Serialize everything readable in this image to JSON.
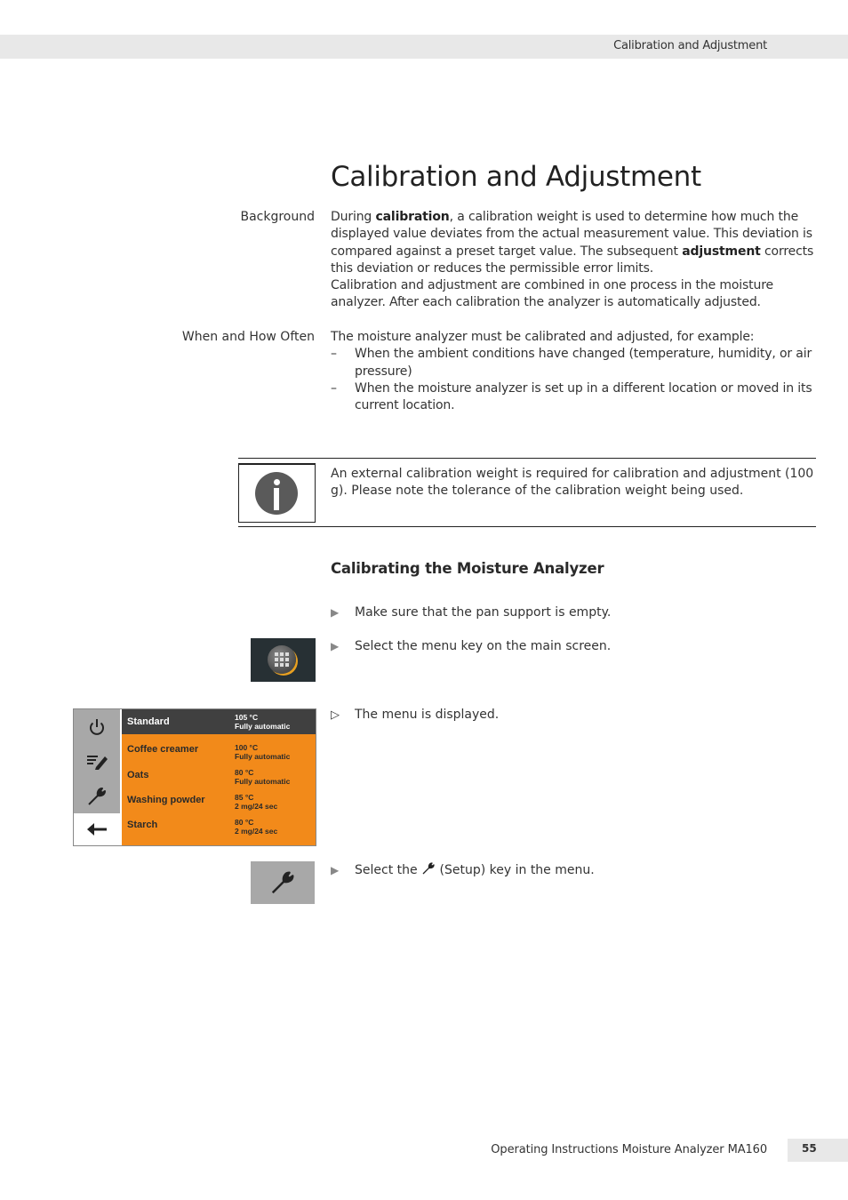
{
  "header": {
    "running_title": "Calibration and Adjustment"
  },
  "page_title": "Calibration and Adjustment",
  "background": {
    "label": "Background",
    "p1_a": "During ",
    "p1_bold1": "calibration",
    "p1_b": ", a calibration weight is used to determine how much the displayed value deviates from the actual measurement value. This deviation is compared against a preset target value. The subsequent ",
    "p1_bold2": "adjustment",
    "p1_c": " corrects this deviation or reduces the permissible error limits.",
    "p2": "Calibration and adjustment are combined in one process in the moisture analyzer. After each calibration the analyzer is automatically adjusted."
  },
  "when_how_often": {
    "label": "When and How Often",
    "intro": "The moisture analyzer must be calibrated and adjusted, for example:",
    "dash": "–",
    "items": [
      "When the ambient conditions have changed (temperature, humidity, or air pressure)",
      "When the moisture analyzer is set up in a different location or moved in its current location."
    ]
  },
  "info_note": {
    "icon": "info-icon",
    "text": "An external calibration weight is required for calibration and adjustment (100 g). Please note the tolerance of the calibration weight being used."
  },
  "section": {
    "heading": "Calibrating the Moisture Analyzer",
    "step_marker": "▶",
    "result_marker": "▷",
    "steps": [
      {
        "text": "Make sure that the pan support is empty."
      },
      {
        "text": "Select the menu key on the main screen.",
        "image_icon": "menu-grid-icon"
      },
      {
        "text": "The menu is displayed.",
        "is_result": true
      },
      {
        "text_before": "Select the ",
        "text_after": " (Setup) key in the menu.",
        "inline_icon": "wrench-icon",
        "image_icon": "wrench-icon"
      }
    ]
  },
  "device_menu": {
    "side_icons": [
      "power-icon",
      "edit-list-icon",
      "wrench-icon",
      "back-arrow-icon"
    ],
    "rows": [
      {
        "name": "Standard",
        "temp": "105 °C",
        "mode": "Fully automatic",
        "selected": true
      },
      {
        "name": "Coffee creamer",
        "temp": "100 °C",
        "mode": "Fully automatic"
      },
      {
        "name": "Oats",
        "temp": "80 °C",
        "mode": "Fully automatic"
      },
      {
        "name": "Washing powder",
        "temp": "85 °C",
        "mode": "2 mg/24 sec"
      },
      {
        "name": "Starch",
        "temp": "80 °C",
        "mode": "2 mg/24 sec"
      }
    ],
    "colors": {
      "list_bg": "#f28a1a",
      "selected_bg": "#404040",
      "sidebar_bg": "#a8a8a8"
    }
  },
  "footer": {
    "title": "Operating Instructions Moisture Analyzer MA160",
    "page_number": "55"
  }
}
